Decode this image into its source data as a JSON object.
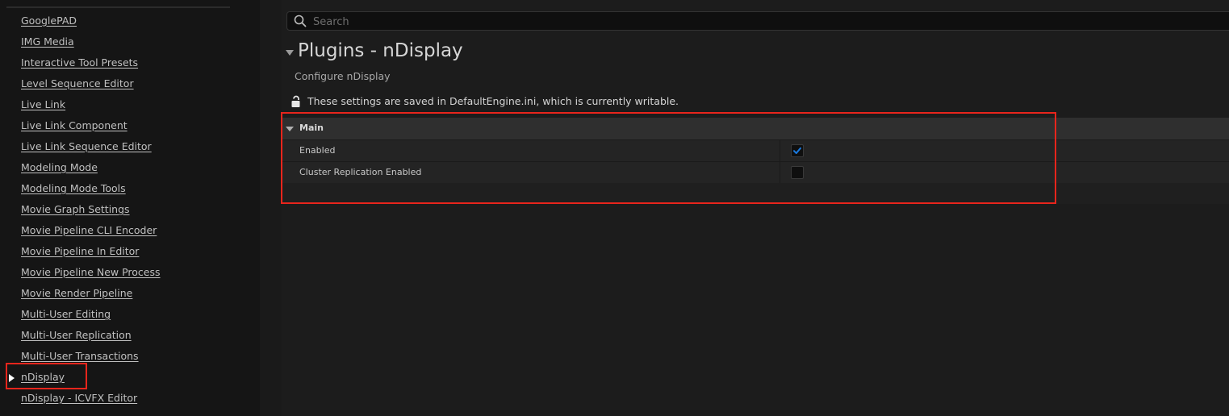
{
  "sidebar": {
    "items": [
      {
        "label": "GooglePAD",
        "selected": false
      },
      {
        "label": "IMG Media",
        "selected": false
      },
      {
        "label": "Interactive Tool Presets",
        "selected": false
      },
      {
        "label": "Level Sequence Editor",
        "selected": false
      },
      {
        "label": "Live Link",
        "selected": false
      },
      {
        "label": "Live Link Component",
        "selected": false
      },
      {
        "label": "Live Link Sequence Editor",
        "selected": false
      },
      {
        "label": "Modeling Mode",
        "selected": false
      },
      {
        "label": "Modeling Mode Tools",
        "selected": false
      },
      {
        "label": "Movie Graph Settings",
        "selected": false
      },
      {
        "label": "Movie Pipeline CLI Encoder",
        "selected": false
      },
      {
        "label": "Movie Pipeline In Editor",
        "selected": false
      },
      {
        "label": "Movie Pipeline New Process",
        "selected": false
      },
      {
        "label": "Movie Render Pipeline",
        "selected": false
      },
      {
        "label": "Multi-User Editing",
        "selected": false
      },
      {
        "label": "Multi-User Replication",
        "selected": false
      },
      {
        "label": "Multi-User Transactions",
        "selected": false
      },
      {
        "label": "nDisplay",
        "selected": true
      },
      {
        "label": "nDisplay - ICVFX Editor",
        "selected": false
      }
    ]
  },
  "search": {
    "placeholder": "Search",
    "value": "",
    "icon": "search-icon"
  },
  "page": {
    "title": "Plugins - nDisplay",
    "subtitle": "Configure nDisplay",
    "lock_icon": "unlocked-lock-icon",
    "save_notice": "These settings are saved in DefaultEngine.ini, which is currently writable."
  },
  "section": {
    "title": "Main",
    "properties": [
      {
        "name": "Enabled",
        "checked": true
      },
      {
        "name": "Cluster Replication Enabled",
        "checked": false
      }
    ]
  },
  "colors": {
    "accent": "#1a7ae0",
    "annotation": "#e8251c",
    "background": "#151515",
    "panel": "#1c1c1c"
  }
}
